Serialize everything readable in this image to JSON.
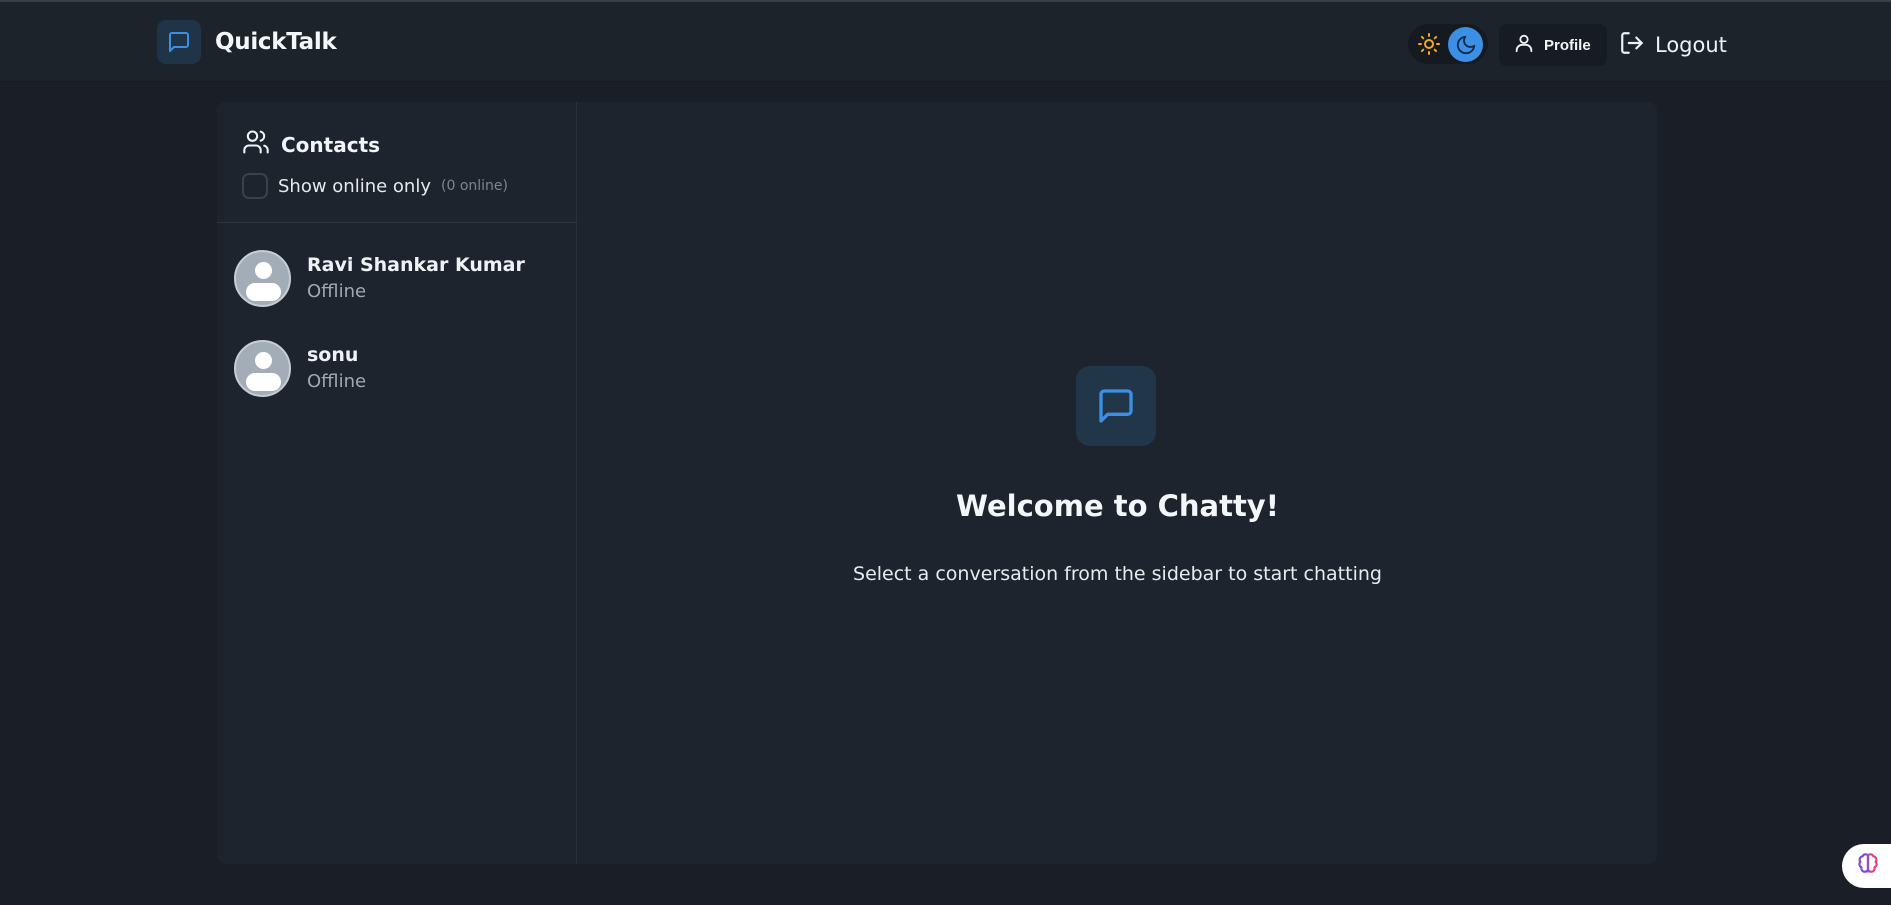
{
  "colors": {
    "accent": "#3b8fe5",
    "background": "#1a1f27",
    "panel": "#1e242d",
    "sun": "#f5a524"
  },
  "navbar": {
    "brand": "QuickTalk",
    "brand_icon": "message-square-icon",
    "profile_label": "Profile",
    "logout_label": "Logout"
  },
  "sidebar": {
    "title": "Contacts",
    "filter_label": "Show online only",
    "online_count": "(0 online)",
    "show_online_only": false,
    "contacts": [
      {
        "name": "Ravi Shankar Kumar",
        "status": "Offline"
      },
      {
        "name": "sonu",
        "status": "Offline"
      }
    ]
  },
  "main": {
    "welcome_title": "Welcome to Chatty!",
    "welcome_subtitle": "Select a conversation from the sidebar to start chatting"
  }
}
